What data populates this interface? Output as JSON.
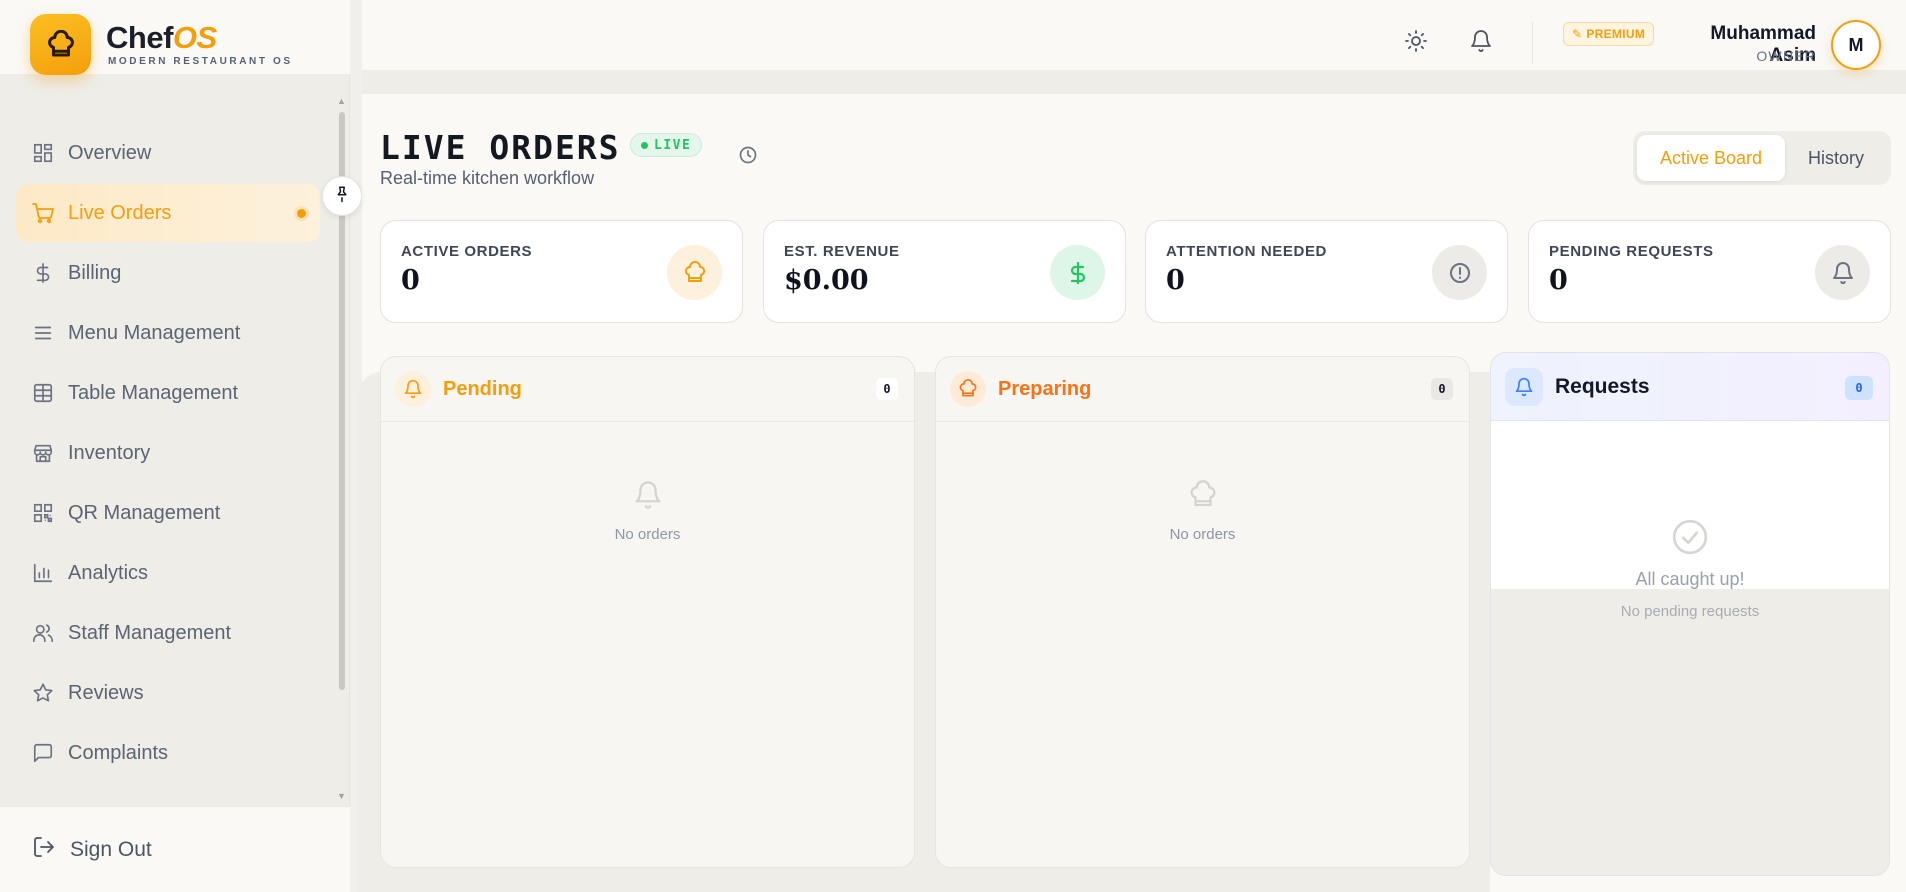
{
  "brand": {
    "name_main": "Chef",
    "name_accent": "OS",
    "tagline": "MODERN RESTAURANT OS"
  },
  "sidebar": {
    "items": [
      {
        "label": "Overview",
        "icon": "overview-grid-icon",
        "active": false
      },
      {
        "label": "Live Orders",
        "icon": "cart-icon",
        "active": true
      },
      {
        "label": "Billing",
        "icon": "dollar-icon",
        "active": false
      },
      {
        "label": "Menu Management",
        "icon": "menu-lines-icon",
        "active": false
      },
      {
        "label": "Table Management",
        "icon": "table-grid-icon",
        "active": false
      },
      {
        "label": "Inventory",
        "icon": "store-icon",
        "active": false
      },
      {
        "label": "QR Management",
        "icon": "qr-code-icon",
        "active": false
      },
      {
        "label": "Analytics",
        "icon": "bar-chart-icon",
        "active": false
      },
      {
        "label": "Staff Management",
        "icon": "users-icon",
        "active": false
      },
      {
        "label": "Reviews",
        "icon": "star-icon",
        "active": false
      },
      {
        "label": "Complaints",
        "icon": "message-square-icon",
        "active": false
      }
    ],
    "sign_out": "Sign Out"
  },
  "header": {
    "premium_label": "PREMIUM",
    "user_name": "Muhammad Asim",
    "user_role": "OWNER",
    "avatar_initial": "M"
  },
  "page": {
    "title": "LIVE ORDERS",
    "live_badge": "LIVE",
    "subtitle": "Real-time kitchen workflow",
    "view_tabs": [
      "Active Board",
      "History"
    ],
    "active_tab": "Active Board"
  },
  "stats": [
    {
      "title": "ACTIVE ORDERS",
      "value": "0",
      "icon": "chef-hat-icon",
      "color": "#f59e0b"
    },
    {
      "title": "EST. REVENUE",
      "value": "$0.00",
      "icon": "dollar-icon",
      "color": "#22c55e"
    },
    {
      "title": "ATTENTION NEEDED",
      "value": "0",
      "icon": "alert-circle-icon",
      "color": "#6b7280"
    },
    {
      "title": "PENDING REQUESTS",
      "value": "0",
      "icon": "bell-icon",
      "color": "#6b7280"
    }
  ],
  "columns": {
    "pending": {
      "title": "Pending",
      "count": "0",
      "empty": "No orders",
      "color": "#f59e0b"
    },
    "preparing": {
      "title": "Preparing",
      "count": "0",
      "empty": "No orders",
      "color": "#f97316"
    },
    "requests": {
      "title": "Requests",
      "count": "0",
      "empty_title": "All caught up!",
      "empty_sub": "No pending requests",
      "color": "#3b82f6"
    }
  },
  "colors": {
    "accent": "#f59e0b",
    "success": "#22c55e",
    "info": "#3b82f6"
  }
}
